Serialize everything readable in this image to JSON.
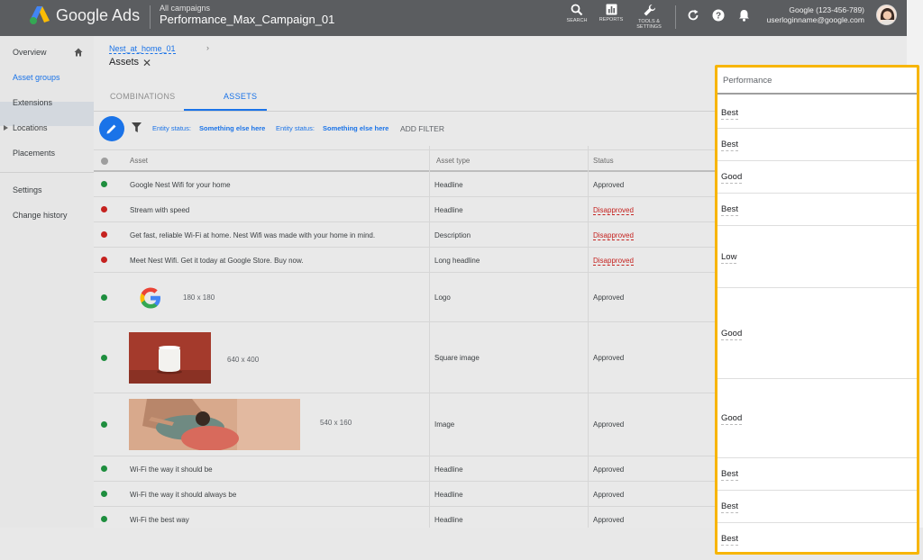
{
  "app": {
    "brand": "Google Ads",
    "breadcrumb_top": "All campaigns",
    "campaign_name": "Performance_Max_Campaign_01",
    "tools": [
      {
        "label": "SEARCH",
        "icon": "search-icon"
      },
      {
        "label": "REPORTS",
        "icon": "reports-icon"
      },
      {
        "label": "TOOLS &",
        "label2": "SETTINGS",
        "icon": "wrench-icon"
      }
    ],
    "account_name": "Google (123-456-789)",
    "account_email": "userloginname@google.com"
  },
  "sidebar": {
    "items": [
      "Overview",
      "Asset groups",
      "Extensions",
      "Locations",
      "Placements",
      "Settings",
      "Change history"
    ]
  },
  "page": {
    "breadcrumb_link": "Nest_at_home_01",
    "breadcrumb_chevron": "›",
    "title": "Assets",
    "close_glyph": "✕",
    "tabs": [
      "COMBINATIONS",
      "ASSETS"
    ],
    "filters": [
      {
        "label": "Entity status:",
        "value": "Something else here"
      },
      {
        "label": "Entity status:",
        "value": "Something else here"
      }
    ],
    "add_filter": "ADD FILTER"
  },
  "table": {
    "columns": [
      "Asset",
      "Asset type",
      "Status"
    ],
    "rows": [
      {
        "asset": "Google Nest Wifi for your home",
        "type": "Headline",
        "status": "Approved",
        "dot": "#1e8e3e"
      },
      {
        "asset": "Stream with speed",
        "type": "Headline",
        "status": "Disapproved",
        "dot": "#c5221f"
      },
      {
        "asset": "Get fast, reliable Wi-Fi at home. Nest Wifi was made with your home in mind.",
        "type": "Description",
        "status": "Disapproved",
        "dot": "#c5221f"
      },
      {
        "asset": "Meet Nest Wifi. Get it today at Google Store. Buy now.",
        "type": "Long headline",
        "status": "Disapproved",
        "dot": "#c5221f"
      },
      {
        "asset": "180 x 180",
        "type": "Logo",
        "status": "Approved",
        "dot": "#1e8e3e"
      },
      {
        "asset": "640 x 400",
        "type": "Square image",
        "status": "Approved",
        "dot": "#1e8e3e"
      },
      {
        "asset": "540 x 160",
        "type": "Image",
        "status": "Approved",
        "dot": "#1e8e3e"
      },
      {
        "asset": "Wi-Fi the way it should be",
        "type": "Headline",
        "status": "Approved",
        "dot": "#1e8e3e"
      },
      {
        "asset": "Wi-Fi the way it should always be",
        "type": "Headline",
        "status": "Approved",
        "dot": "#1e8e3e"
      },
      {
        "asset": "Wi-Fi the best way",
        "type": "Headline",
        "status": "Approved",
        "dot": "#1e8e3e"
      }
    ]
  },
  "performance": {
    "header": "Performance",
    "values": [
      "Best",
      "Best",
      "Good",
      "Best",
      "Low",
      "Good",
      "Good",
      "Best",
      "Best",
      "Best"
    ],
    "highlight_color": "#f7b500"
  }
}
